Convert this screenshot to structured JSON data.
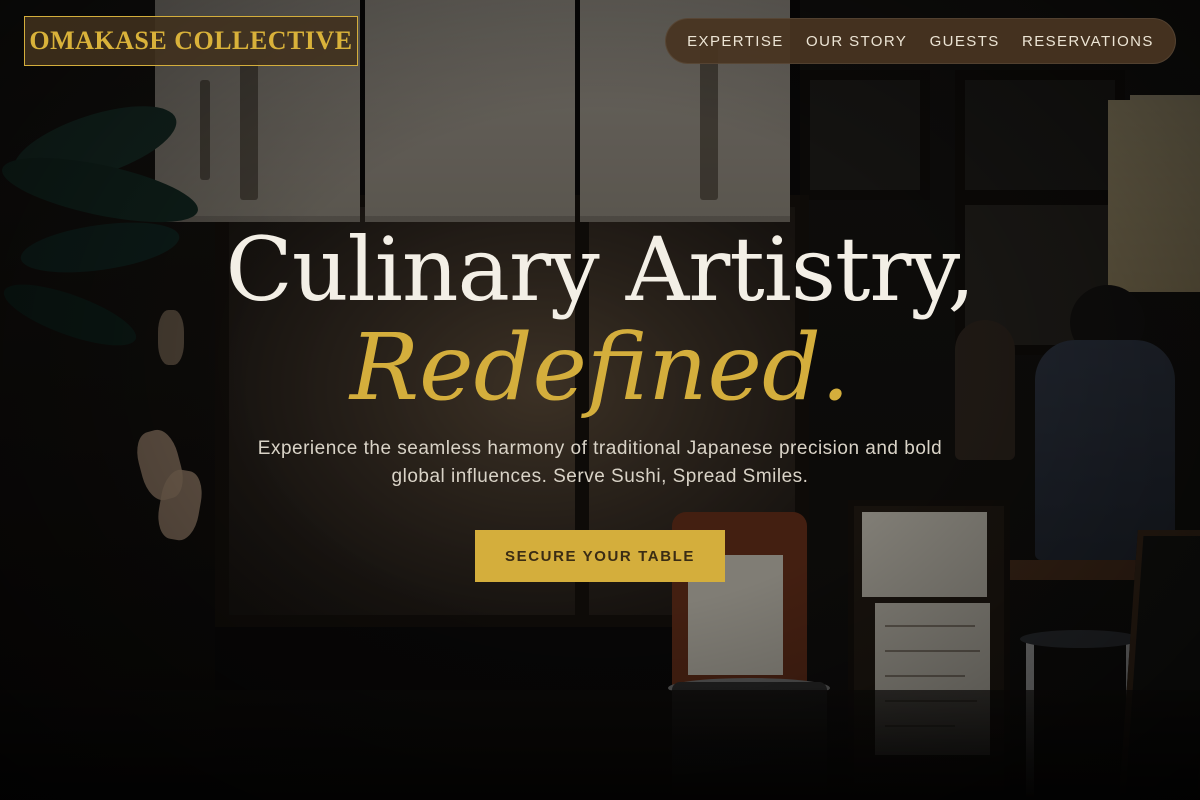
{
  "brand": {
    "name": "OMAKASE COLLECTIVE"
  },
  "nav": {
    "items": [
      {
        "label": "EXPERTISE"
      },
      {
        "label": "OUR STORY"
      },
      {
        "label": "GUESTS"
      },
      {
        "label": "RESERVATIONS"
      }
    ]
  },
  "hero": {
    "title": "Culinary Artistry,",
    "accent": "Redefined.",
    "subtitle": "Experience the seamless harmony of traditional Japanese precision and bold global influences. Serve Sushi, Spread Smiles.",
    "cta_label": "SECURE YOUR TABLE"
  },
  "colors": {
    "accent_gold": "#d4ae3c",
    "nav_background": "#483421",
    "text_light": "#f3efe6"
  }
}
